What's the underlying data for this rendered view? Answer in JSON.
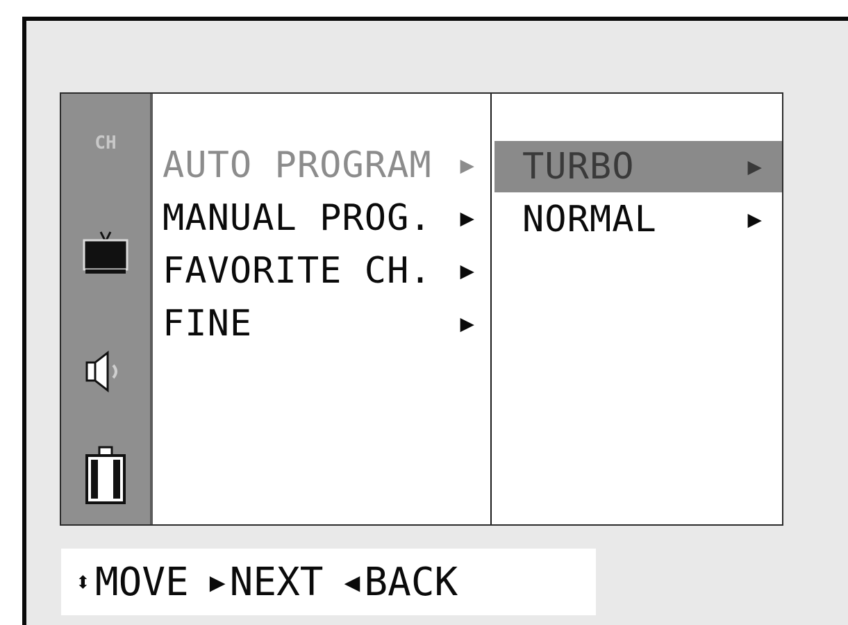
{
  "menu": {
    "items": [
      {
        "label": "AUTO PROGRAM",
        "arrow": "▶",
        "state": "dim"
      },
      {
        "label": "MANUAL PROG.",
        "arrow": "▶",
        "state": "normal"
      },
      {
        "label": "FAVORITE CH.",
        "arrow": "▶",
        "state": "normal"
      },
      {
        "label": "FINE",
        "arrow": "▶",
        "state": "normal"
      }
    ]
  },
  "submenu": {
    "items": [
      {
        "label": "TURBO",
        "arrow": "▶",
        "selected": true
      },
      {
        "label": "NORMAL",
        "arrow": "▶",
        "selected": false
      }
    ]
  },
  "sidebar_icons": [
    {
      "icon": "channel-icon",
      "text": "CH"
    },
    {
      "icon": "tv-picture-icon"
    },
    {
      "icon": "speaker-sound-icon"
    },
    {
      "icon": "clock-timer-icon"
    }
  ],
  "hints": [
    {
      "glyph": "⬍",
      "label": "MOVE",
      "icon": "up-down-arrow-icon"
    },
    {
      "glyph": "▶",
      "label": "NEXT",
      "icon": "right-arrow-icon"
    },
    {
      "glyph": "◀",
      "label": "BACK",
      "icon": "left-arrow-icon"
    }
  ],
  "colors": {
    "panel_bg": "#e9e9e9",
    "icon_bar": "#8f8f8f",
    "selected_row": "#8a8a8a",
    "dim_text": "#8c8c8c",
    "text": "#0a0a0a"
  }
}
